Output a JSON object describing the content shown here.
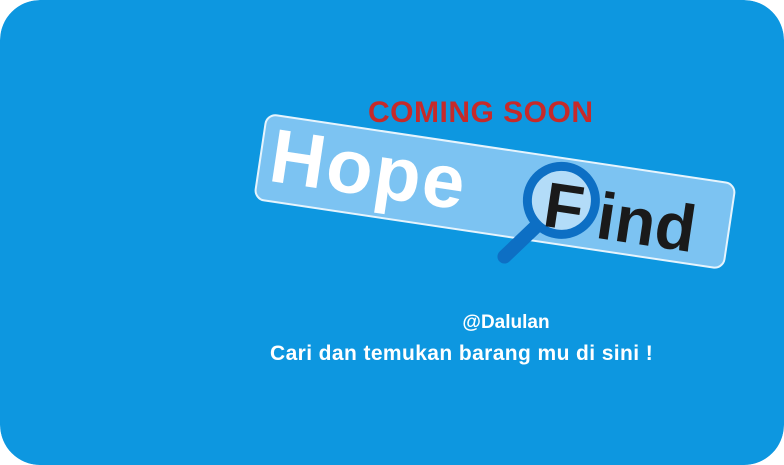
{
  "colors": {
    "background": "#0d97e0",
    "coming_soon": "#c62a2a",
    "logo_band": "#7cc3f2",
    "logo_band_stroke": "#e6f4fd",
    "hope_text": "#ffffff",
    "find_text": "#1a1a1a",
    "magnifier_ring": "#0d6fc4",
    "magnifier_fill": "#b3dcf8"
  },
  "banner": {
    "coming_soon": "COMING SOON",
    "logo_word_1": "Hope",
    "logo_word_2_letter": "F",
    "logo_word_2_rest": "ind",
    "handle": "@Dalulan",
    "tagline": "Cari dan temukan barang mu di sini !",
    "logo_icon": "magnifier-icon"
  }
}
